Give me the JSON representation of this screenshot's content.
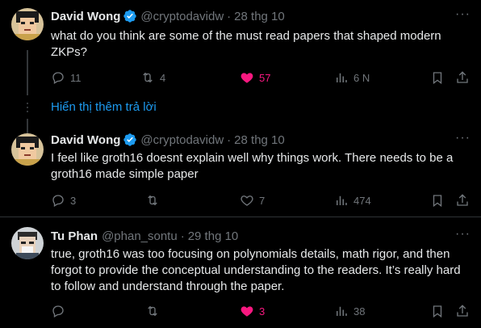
{
  "tweets": [
    {
      "name": "David Wong",
      "handle": "@cryptodavidw",
      "date": "28 thg 10",
      "text": "what do you think are some of the must read papers that shaped modern ZKPs?",
      "replies": "11",
      "retweets": "4",
      "likes": "57",
      "views": "6 N",
      "liked": true
    },
    {
      "name": "David Wong",
      "handle": "@cryptodavidw",
      "date": "28 thg 10",
      "text": "I feel like groth16 doesnt explain well why things work. There needs to be a groth16 made simple paper",
      "replies": "3",
      "retweets": "",
      "likes": "7",
      "views": "474",
      "liked": false
    },
    {
      "name": "Tu Phan",
      "handle": "@phan_sontu",
      "date": "29 thg 10",
      "text": "true, groth16 was too focusing on polynomials details, math rigor, and then forgot to provide the conceptual understanding to the readers. It’s really hard to follow and understand through the paper.",
      "replies": "",
      "retweets": "",
      "likes": "3",
      "views": "38",
      "liked": true
    }
  ],
  "show_more_replies": "Hiển thị thêm trả lời",
  "separator": "·",
  "colors": {
    "accent": "#1d9bf0",
    "like": "#f91880",
    "muted": "#71767b",
    "text": "#e7e9ea"
  }
}
